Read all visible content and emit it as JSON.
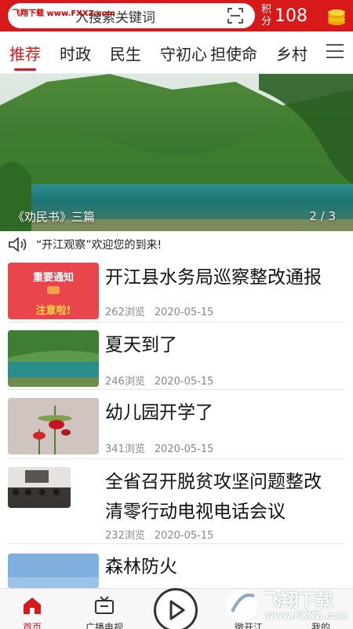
{
  "header": {
    "search_placeholder": "入搜索关键词",
    "watermark_site": "飞翔下载 www.FXXZ.com",
    "points_label": "积分",
    "points_value": "108"
  },
  "tabs": [
    "推荐",
    "时政",
    "民生",
    "守初心",
    "担使命",
    "乡村"
  ],
  "banner": {
    "caption": "《劝民书》三篇",
    "page": "2 / 3"
  },
  "notice": {
    "text": "“开江观察”欢迎您的到来!"
  },
  "articles": [
    {
      "title": "开江县水务局巡察整改通报",
      "views": "262浏览",
      "date": "2020-05-15",
      "thumb_line1": "重要通知",
      "thumb_line2": "注意啦!"
    },
    {
      "title": "夏天到了",
      "views": "246浏览",
      "date": "2020-05-15"
    },
    {
      "title": "幼儿园开学了",
      "views": "341浏览",
      "date": "2020-05-15"
    },
    {
      "title": "全省召开脱贫攻坚问题整改清零行动电视电话会议",
      "title_line1": "全省召开脱贫攻坚问题整改",
      "title_line2": "清零行动电视电话会议",
      "views": "232浏览",
      "date": "2020-05-15"
    },
    {
      "title": "森林防火"
    }
  ],
  "bottom_nav": {
    "home": "首页",
    "broadcast": "广播电视",
    "wei": "微开江",
    "mine": "我的"
  },
  "watermark": {
    "brand": "飞翔下载",
    "url": "www.FXXZ.com"
  },
  "colors": {
    "accent": "#d8191a"
  }
}
